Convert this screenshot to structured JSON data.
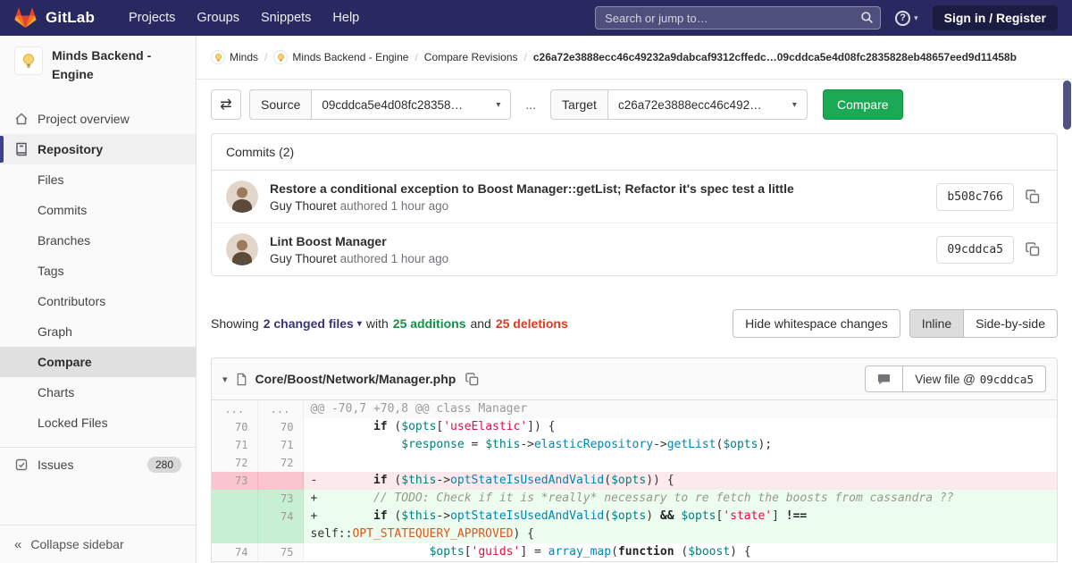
{
  "colors": {
    "navbar_bg": "#292961",
    "success_green": "#1aaa55",
    "additions_green": "#168f48",
    "deletions_red": "#db3b21"
  },
  "icons": {
    "help": "?",
    "chevron_down": "▾",
    "caret_down": "▾",
    "swap": "⇄",
    "collapse": "«"
  },
  "navbar": {
    "brand": "GitLab",
    "links": [
      "Projects",
      "Groups",
      "Snippets",
      "Help"
    ],
    "search_placeholder": "Search or jump to…",
    "signin_label": "Sign in / Register"
  },
  "sidebar": {
    "project_title": "Minds Backend - Engine",
    "overview_label": "Project overview",
    "repository_label": "Repository",
    "repo_items": [
      "Files",
      "Commits",
      "Branches",
      "Tags",
      "Contributors",
      "Graph",
      "Compare",
      "Charts",
      "Locked Files"
    ],
    "active_item": "Compare",
    "issues_label": "Issues",
    "issues_count": "280",
    "collapse_label": "Collapse sidebar"
  },
  "breadcrumb": {
    "separator": "/",
    "items": [
      {
        "label": "Minds"
      },
      {
        "label": "Minds Backend - Engine"
      },
      {
        "label": "Compare Revisions"
      }
    ],
    "current": "c26a72e3888ecc46c49232a9dabcaf9312cffedc…09cddca5e4d08fc2835828eb48657eed9d11458b"
  },
  "compare_form": {
    "source_label": "Source",
    "source_value": "09cddca5e4d08fc28358…",
    "separator": "...",
    "target_label": "Target",
    "target_value": "c26a72e3888ecc46c492…",
    "compare_button": "Compare"
  },
  "commits": {
    "header": "Commits (2)",
    "items": [
      {
        "title": "Restore a conditional exception to Boost Manager::getList; Refactor it's spec test a little",
        "author": "Guy Thouret",
        "meta": "authored 1 hour ago",
        "sha": "b508c766"
      },
      {
        "title": "Lint Boost Manager",
        "author": "Guy Thouret",
        "meta": "authored 1 hour ago",
        "sha": "09cddca5"
      }
    ]
  },
  "diff_stats": {
    "showing_label": "Showing",
    "files_label": "2 changed files",
    "with_label": "with",
    "additions_label": "25 additions",
    "and_label": "and",
    "deletions_label": "25 deletions",
    "whitespace_button": "Hide whitespace changes",
    "inline_button": "Inline",
    "side_by_side_button": "Side-by-side"
  },
  "diff_file": {
    "path": "Core/Boost/Network/Manager.php",
    "view_file_label": "View file @",
    "view_file_sha": "09cddca5",
    "lines": [
      {
        "type": "hunk",
        "old": "...",
        "new": "...",
        "sign": "",
        "segs": [
          {
            "t": "@@ -70,7 +70,8 @@ class Manager",
            "c": "hunktext"
          }
        ]
      },
      {
        "type": "ctx",
        "old": "70",
        "new": "70",
        "sign": " ",
        "segs": [
          {
            "t": "        ",
            "c": ""
          },
          {
            "t": "if",
            "c": "kw"
          },
          {
            "t": " (",
            "c": ""
          },
          {
            "t": "$opts",
            "c": "var"
          },
          {
            "t": "[",
            "c": ""
          },
          {
            "t": "'useElastic'",
            "c": "str"
          },
          {
            "t": "]) {",
            "c": ""
          }
        ]
      },
      {
        "type": "ctx",
        "old": "71",
        "new": "71",
        "sign": " ",
        "segs": [
          {
            "t": "            ",
            "c": ""
          },
          {
            "t": "$response",
            "c": "var"
          },
          {
            "t": " = ",
            "c": ""
          },
          {
            "t": "$this",
            "c": "var"
          },
          {
            "t": "->",
            "c": ""
          },
          {
            "t": "elasticRepository",
            "c": "fn"
          },
          {
            "t": "->",
            "c": ""
          },
          {
            "t": "getList",
            "c": "fn"
          },
          {
            "t": "(",
            "c": ""
          },
          {
            "t": "$opts",
            "c": "var"
          },
          {
            "t": ");",
            "c": ""
          }
        ]
      },
      {
        "type": "ctx",
        "old": "72",
        "new": "72",
        "sign": " ",
        "segs": []
      },
      {
        "type": "del",
        "old": "73",
        "new": "",
        "sign": "-",
        "segs": [
          {
            "t": "        ",
            "c": ""
          },
          {
            "t": "if",
            "c": "kw"
          },
          {
            "t": " (",
            "c": ""
          },
          {
            "t": "$this",
            "c": "var"
          },
          {
            "t": "->",
            "c": ""
          },
          {
            "t": "optStateIsUsedAndValid",
            "c": "fn"
          },
          {
            "t": "(",
            "c": ""
          },
          {
            "t": "$opts",
            "c": "var"
          },
          {
            "t": ")) {",
            "c": ""
          }
        ]
      },
      {
        "type": "add",
        "old": "",
        "new": "73",
        "sign": "+",
        "segs": [
          {
            "t": "        ",
            "c": ""
          },
          {
            "t": "// TODO: Check if it is *really* necessary to re fetch the boosts from cassandra ??",
            "c": "cm"
          }
        ]
      },
      {
        "type": "add",
        "old": "",
        "new": "74",
        "sign": "+",
        "segs": [
          {
            "t": "        ",
            "c": ""
          },
          {
            "t": "if",
            "c": "kw"
          },
          {
            "t": " (",
            "c": ""
          },
          {
            "t": "$this",
            "c": "var"
          },
          {
            "t": "->",
            "c": ""
          },
          {
            "t": "optStateIsUsedAndValid",
            "c": "fn"
          },
          {
            "t": "(",
            "c": ""
          },
          {
            "t": "$opts",
            "c": "var"
          },
          {
            "t": ") ",
            "c": ""
          },
          {
            "t": "&&",
            "c": "kw"
          },
          {
            "t": " ",
            "c": ""
          },
          {
            "t": "$opts",
            "c": "var"
          },
          {
            "t": "[",
            "c": ""
          },
          {
            "t": "'state'",
            "c": "str"
          },
          {
            "t": "] ",
            "c": ""
          },
          {
            "t": "!==",
            "c": "kw"
          },
          {
            "t": " ",
            "c": ""
          },
          {
            "t": "self::",
            "c": ""
          },
          {
            "t": "OPT_STATEQUERY_APPROVED",
            "c": "cst"
          },
          {
            "t": ") {",
            "c": ""
          }
        ]
      },
      {
        "type": "ctx",
        "old": "74",
        "new": "75",
        "sign": " ",
        "segs": [
          {
            "t": "                ",
            "c": ""
          },
          {
            "t": "$opts",
            "c": "var"
          },
          {
            "t": "[",
            "c": ""
          },
          {
            "t": "'guids'",
            "c": "str"
          },
          {
            "t": "] = ",
            "c": ""
          },
          {
            "t": "array_map",
            "c": "fn"
          },
          {
            "t": "(",
            "c": ""
          },
          {
            "t": "function",
            "c": "kw"
          },
          {
            "t": " (",
            "c": ""
          },
          {
            "t": "$boost",
            "c": "var"
          },
          {
            "t": ") {",
            "c": ""
          }
        ]
      }
    ]
  }
}
